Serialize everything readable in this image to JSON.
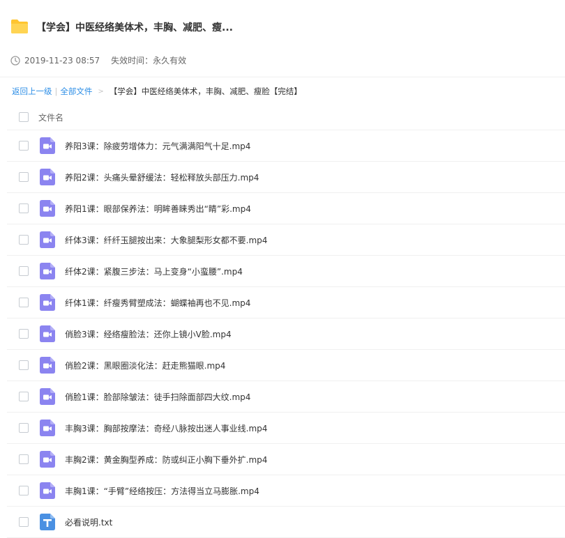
{
  "share": {
    "title": "【学会】中医经络美体术，丰胸、减肥、瘦...",
    "date": "2019-11-23 08:57",
    "expire_label": "失效时间：永久有效"
  },
  "breadcrumb": {
    "back": "返回上一级",
    "separator": "|",
    "all_files": "全部文件",
    "arrow": ">",
    "current": "【学会】中医经络美体术，丰胸、减肥、瘦脸【完结】"
  },
  "list_header": {
    "name_label": "文件名"
  },
  "files": [
    {
      "name": "养阳3课：除疲劳增体力：元气满满阳气十足.mp4",
      "icon": "video-file-icon"
    },
    {
      "name": "养阳2课：头痛头晕舒缓法：轻松释放头部压力.mp4",
      "icon": "video-file-icon"
    },
    {
      "name": "养阳1课：眼部保养法：明眸善睐秀出“睛”彩.mp4",
      "icon": "video-file-icon"
    },
    {
      "name": "纤体3课：纤纤玉腿按出来：大象腿梨形女都不要.mp4",
      "icon": "video-file-icon"
    },
    {
      "name": "纤体2课：紧腹三步法：马上变身“小蛮腰”.mp4",
      "icon": "video-file-icon"
    },
    {
      "name": "纤体1课：纤瘦秀臂塑成法：蝴蝶袖再也不见.mp4",
      "icon": "video-file-icon"
    },
    {
      "name": "俏脸3课：经络瘦脸法：还你上镜小V脸.mp4",
      "icon": "video-file-icon"
    },
    {
      "name": "俏脸2课：黑眼圈淡化法：赶走熊猫眼.mp4",
      "icon": "video-file-icon"
    },
    {
      "name": "俏脸1课：脸部除皱法：徒手扫除面部四大纹.mp4",
      "icon": "video-file-icon"
    },
    {
      "name": "丰胸3课：胸部按摩法：奇经八脉按出迷人事业线.mp4",
      "icon": "video-file-icon"
    },
    {
      "name": "丰胸2课：黄金胸型养成：防或纠正小胸下垂外扩.mp4",
      "icon": "video-file-icon"
    },
    {
      "name": "丰胸1课：“手臂”经络按压：方法得当立马膨胀.mp4",
      "icon": "video-file-icon"
    },
    {
      "name": "必看说明.txt",
      "icon": "text-file-icon"
    }
  ],
  "colors": {
    "folder": "#ffc530",
    "video_icon": "#8b84f0",
    "text_icon": "#4a90e2",
    "link": "#2b8de6"
  }
}
